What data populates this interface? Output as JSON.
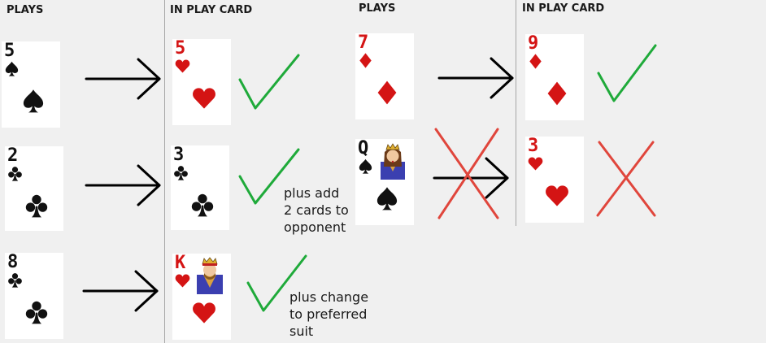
{
  "headers": {
    "left_plays": "PLAYS",
    "left_in_play": "IN PLAY CARD",
    "right_plays": "PLAYS",
    "right_in_play": "IN PLAY CARD"
  },
  "cards": {
    "left_row1_play": {
      "rank": "5",
      "suit": "spade",
      "color": "black"
    },
    "left_row1_inplay": {
      "rank": "5",
      "suit": "heart",
      "color": "red"
    },
    "left_row2_play": {
      "rank": "2",
      "suit": "club",
      "color": "black"
    },
    "left_row2_inplay": {
      "rank": "3",
      "suit": "club",
      "color": "black"
    },
    "left_row3_play": {
      "rank": "8",
      "suit": "club",
      "color": "black"
    },
    "left_row3_inplay": {
      "rank": "K",
      "suit": "heart",
      "color": "red",
      "face": "king"
    },
    "right_row1_play": {
      "rank": "7",
      "suit": "diamond",
      "color": "red"
    },
    "right_row1_inplay": {
      "rank": "9",
      "suit": "diamond",
      "color": "red"
    },
    "right_row2_play": {
      "rank": "Q",
      "suit": "spade",
      "color": "black",
      "face": "queen"
    },
    "right_row2_inplay": {
      "rank": "3",
      "suit": "heart",
      "color": "red"
    }
  },
  "notes": {
    "row2": [
      "plus add",
      "2 cards to",
      "opponent"
    ],
    "row3": [
      "plus change",
      "to preferred",
      "suit"
    ]
  },
  "marks": {
    "valid_icon": "check-mark",
    "invalid_icon": "x-mark",
    "valid_color": "#1faa3a",
    "invalid_color": "#e0463c"
  },
  "colors": {
    "red_suit": "#d41414",
    "black_suit": "#111111",
    "background": "#f0f0f0",
    "divider": "#a6a6a6"
  }
}
